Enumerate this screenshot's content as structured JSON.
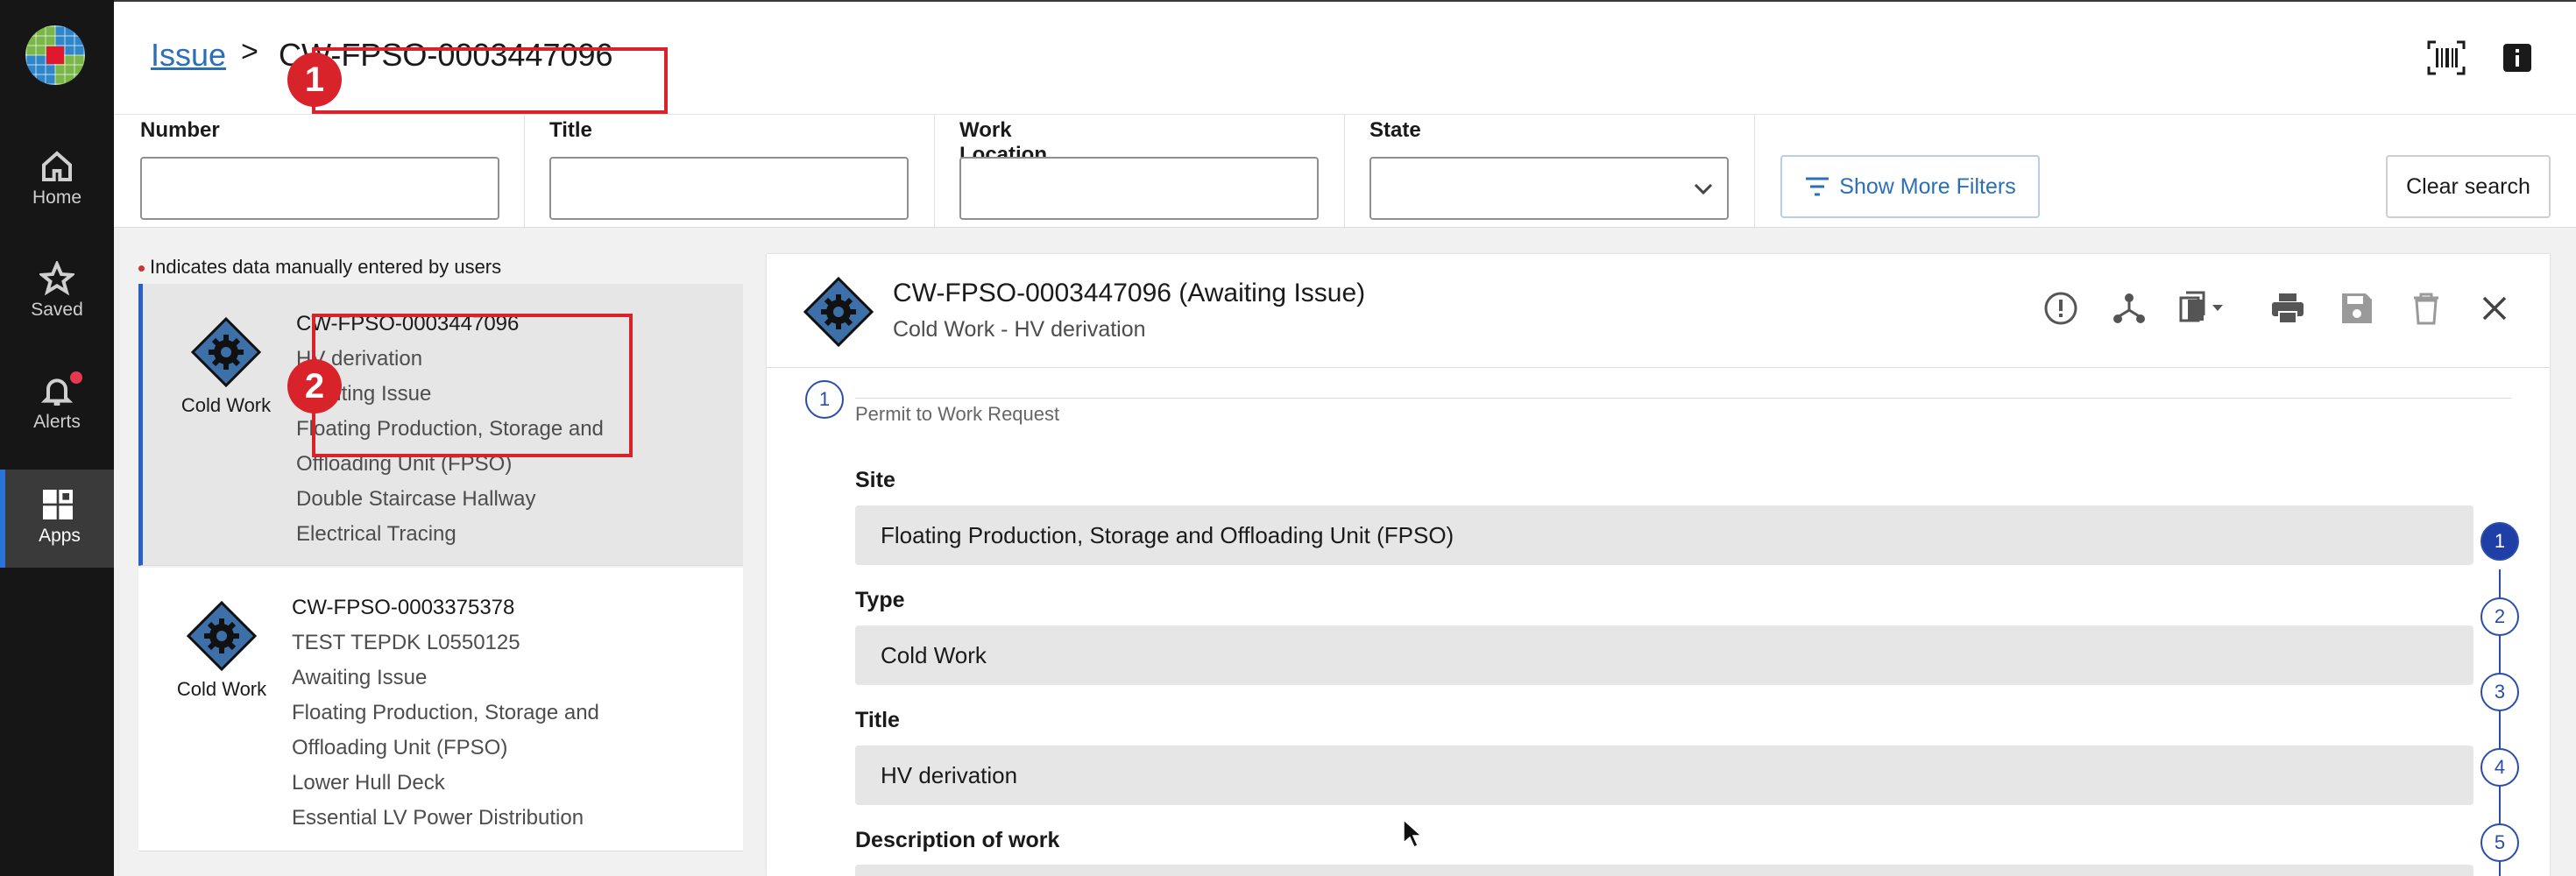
{
  "sidebar": {
    "items": [
      {
        "label": "Home",
        "icon": "home-icon"
      },
      {
        "label": "Saved",
        "icon": "star-icon"
      },
      {
        "label": "Alerts",
        "icon": "bell-icon"
      },
      {
        "label": "Apps",
        "icon": "apps-grid-icon"
      }
    ]
  },
  "header": {
    "breadcrumb_link": "Issue",
    "breadcrumb_separator": ">",
    "breadcrumb_current": "CW-FPSO-0003447096",
    "icons": [
      "barcode-icon",
      "info-icon"
    ]
  },
  "filters": {
    "number_label": "Number",
    "title_label": "Title",
    "work_location_label": "Work Location",
    "state_label": "State",
    "show_more_label": "Show More Filters",
    "clear_label": "Clear search"
  },
  "list": {
    "note": "Indicates data manually entered by users",
    "cards": [
      {
        "type": "Cold Work",
        "lines": [
          "CW-FPSO-0003447096",
          "HV derivation",
          "Awaiting Issue",
          "Floating Production, Storage and",
          "Offloading Unit (FPSO)",
          "Double Staircase Hallway",
          "Electrical Tracing"
        ]
      },
      {
        "type": "Cold Work",
        "lines": [
          "CW-FPSO-0003375378",
          "TEST TEPDK L0550125",
          "Awaiting Issue",
          "Floating Production, Storage and",
          "Offloading Unit (FPSO)",
          "Lower Hull Deck",
          "Essential LV Power Distribution"
        ]
      }
    ]
  },
  "panel": {
    "title": "CW-FPSO-0003447096 (Awaiting Issue)",
    "subtitle": "Cold Work - HV derivation",
    "tools": [
      "alert-circle-icon",
      "hierarchy-icon",
      "copy-dropdown-icon",
      "print-icon",
      "save-icon",
      "delete-icon",
      "close-icon"
    ],
    "section_number": "1",
    "section_title": "Permit to Work Request",
    "fields": [
      {
        "label": "Site",
        "value": "Floating Production, Storage and Offloading Unit (FPSO)"
      },
      {
        "label": "Type",
        "value": "Cold Work"
      },
      {
        "label": "Title",
        "value": "HV derivation"
      },
      {
        "label": "Description of work",
        "value": ""
      }
    ],
    "steps": [
      "1",
      "2",
      "3",
      "4",
      "5"
    ]
  },
  "annotations": [
    "1",
    "2"
  ],
  "colors": {
    "accent": "#2a6fb8",
    "annotation": "#d8232a",
    "sidebar": "#161616",
    "step_active": "#1f3fa6"
  }
}
